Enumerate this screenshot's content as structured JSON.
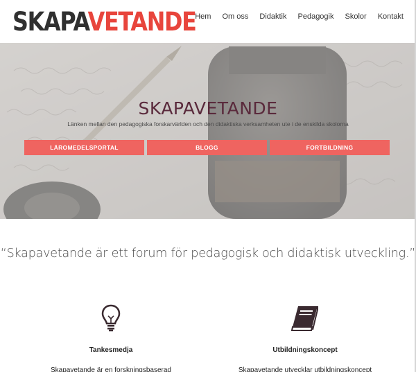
{
  "header": {
    "logo_part1": "SKAPA",
    "logo_part2": "VETANDE",
    "nav": [
      "Hem",
      "Om oss",
      "Didaktik",
      "Pedagogik",
      "Skolor",
      "Kontakt"
    ]
  },
  "hero": {
    "title": "SKAPAVETANDE",
    "subtitle": "Länken mellan den pedagogiska forskarvärlden och den didaktiska verksamheten ute i de enskilda skolorna",
    "buttons": [
      "LÄROMEDELSPORTAL",
      "BLOGG",
      "FORTBILDNING"
    ]
  },
  "quote": "“Skapavetande är ett forum för pedagogisk och didaktisk utveckling.”",
  "features": [
    {
      "icon": "lightbulb-icon",
      "title": "Tankesmedja",
      "text": "Skapavetande är en forskningsbaserad"
    },
    {
      "icon": "book-icon",
      "title": "Utbildningskoncept",
      "text": "Skapavetande utvecklar utbildningskoncept"
    }
  ],
  "colors": {
    "accent": "#ef6460",
    "brand_red": "#e8453c",
    "title": "#5a2a3c"
  }
}
